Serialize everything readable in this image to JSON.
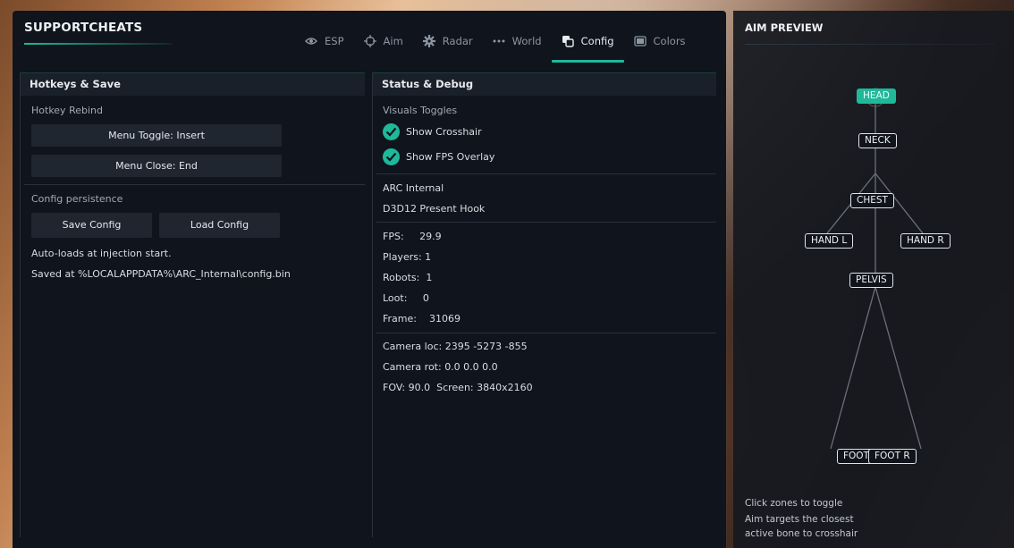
{
  "app": {
    "brand": "SUPPORTCHEATS"
  },
  "tabs": [
    {
      "label": "ESP",
      "icon": "eye-icon"
    },
    {
      "label": "Aim",
      "icon": "crosshair-icon"
    },
    {
      "label": "Radar",
      "icon": "gear-icon"
    },
    {
      "label": "World",
      "icon": "dots-icon"
    },
    {
      "label": "Config",
      "icon": "config-icon",
      "active": true
    },
    {
      "label": "Colors",
      "icon": "palette-icon"
    }
  ],
  "hotkeys": {
    "title": "Hotkeys & Save",
    "rebind_label": "Hotkey Rebind",
    "menu_toggle": "Menu Toggle: Insert",
    "menu_close": "Menu Close: End",
    "persistence_label": "Config persistence",
    "save_button": "Save Config",
    "load_button": "Load Config",
    "autoload_note": "Auto-loads at injection start.",
    "saved_path": "Saved at %LOCALAPPDATA%\\ARC_Internal\\config.bin"
  },
  "status": {
    "title": "Status & Debug",
    "visuals_label": "Visuals Toggles",
    "show_crosshair": "Show Crosshair",
    "show_fps": "Show FPS Overlay",
    "arc_internal": "ARC Internal",
    "hook": "D3D12 Present Hook",
    "fps": "FPS:     29.9",
    "players": "Players: 1",
    "robots": "Robots:  1",
    "loot": "Loot:     0",
    "frame": "Frame:    31069",
    "camera_loc": "Camera loc: 2395 -5273 -855",
    "camera_rot": "Camera rot: 0.0 0.0 0.0",
    "fov": "FOV: 90.0  Screen: 3840x2160"
  },
  "aim_preview": {
    "title": "AIM PREVIEW",
    "bones": {
      "head": "HEAD",
      "neck": "NECK",
      "chest": "CHEST",
      "hand_l": "HAND L",
      "hand_r": "HAND R",
      "pelvis": "PELVIS",
      "foot_l": "FOOT L",
      "foot_r": "FOOT R"
    },
    "note1": "Click zones to toggle",
    "note2": "Aim targets the closest",
    "note3": "active bone to crosshair"
  },
  "colors": {
    "accent": "#1fb99a",
    "panel": "#0f141d",
    "header": "#1a202a"
  }
}
